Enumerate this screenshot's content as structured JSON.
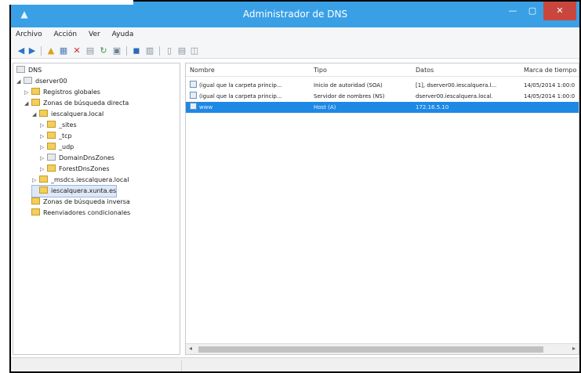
{
  "window": {
    "title": "Administrador de DNS",
    "app_icon": "dns-manager-icon"
  },
  "menu": {
    "items": [
      "Archivo",
      "Acción",
      "Ver",
      "Ayuda"
    ]
  },
  "tree": {
    "root": "DNS",
    "server": "dserver00",
    "global_logs": "Registros globales",
    "forward_zones": "Zonas de búsqueda directa",
    "zone": "iescalquera.local",
    "sites": "_sites",
    "tcp": "_tcp",
    "udp": "_udp",
    "domaindns": "DomainDnsZones",
    "forestdns": "ForestDnsZones",
    "msdcs": "_msdcs.iescalquera.local",
    "xunta": "iescalquera.xunta.es",
    "reverse_zones": "Zonas de búsqueda inversa",
    "conditional": "Reenviadores condicionales"
  },
  "list": {
    "columns": [
      "Nombre",
      "Tipo",
      "Datos",
      "Marca de tiempo"
    ],
    "rows": [
      {
        "name": "(igual que la carpeta princip...",
        "type": "Inicio de autoridad (SOA)",
        "data": "[1], dserver00.iescalquera.l...",
        "time": "14/05/2014 1:00:0"
      },
      {
        "name": "(igual que la carpeta princip...",
        "type": "Servidor de nombres (NS)",
        "data": "dserver00.iescalquera.local.",
        "time": "14/05/2014 1:00:0"
      },
      {
        "name": "www",
        "type": "Host (A)",
        "data": "172.16.5.10",
        "time": ""
      }
    ]
  },
  "colors": {
    "titlebar": "#3aa0e6",
    "selection": "#1e88e5",
    "close": "#c9463d"
  }
}
